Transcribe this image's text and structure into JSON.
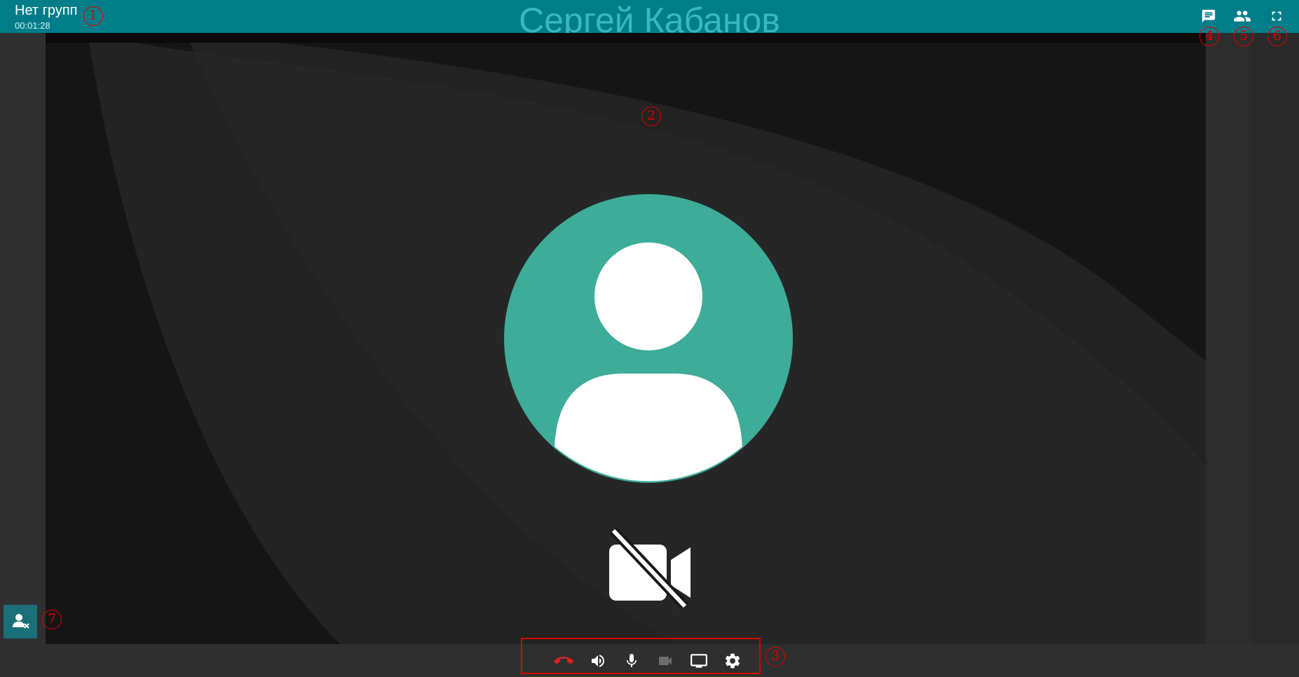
{
  "header": {
    "group_title": "Нет групп",
    "timer": "00:01:28",
    "caller_name": "Сергей Кабанов",
    "icons": [
      "chat-icon",
      "participants-icon",
      "fullscreen-icon"
    ]
  },
  "stage": {
    "avatar_icon": "user-avatar-icon",
    "camera_status_icon": "camera-off-icon",
    "avatar_color": "#3dac98"
  },
  "controls": {
    "icons": [
      "hang-up-icon",
      "speaker-icon",
      "microphone-icon",
      "camera-icon",
      "screen-share-icon",
      "settings-icon"
    ],
    "hangup_color": "#e02020"
  },
  "side": {
    "remove_user_icon": "remove-user-icon"
  },
  "annotations": [
    "1",
    "2",
    "3",
    "4",
    "5",
    "6",
    "7"
  ],
  "colors": {
    "accent": "#017d8a",
    "caller_name": "#38b6c1",
    "annotation": "#e00000"
  }
}
